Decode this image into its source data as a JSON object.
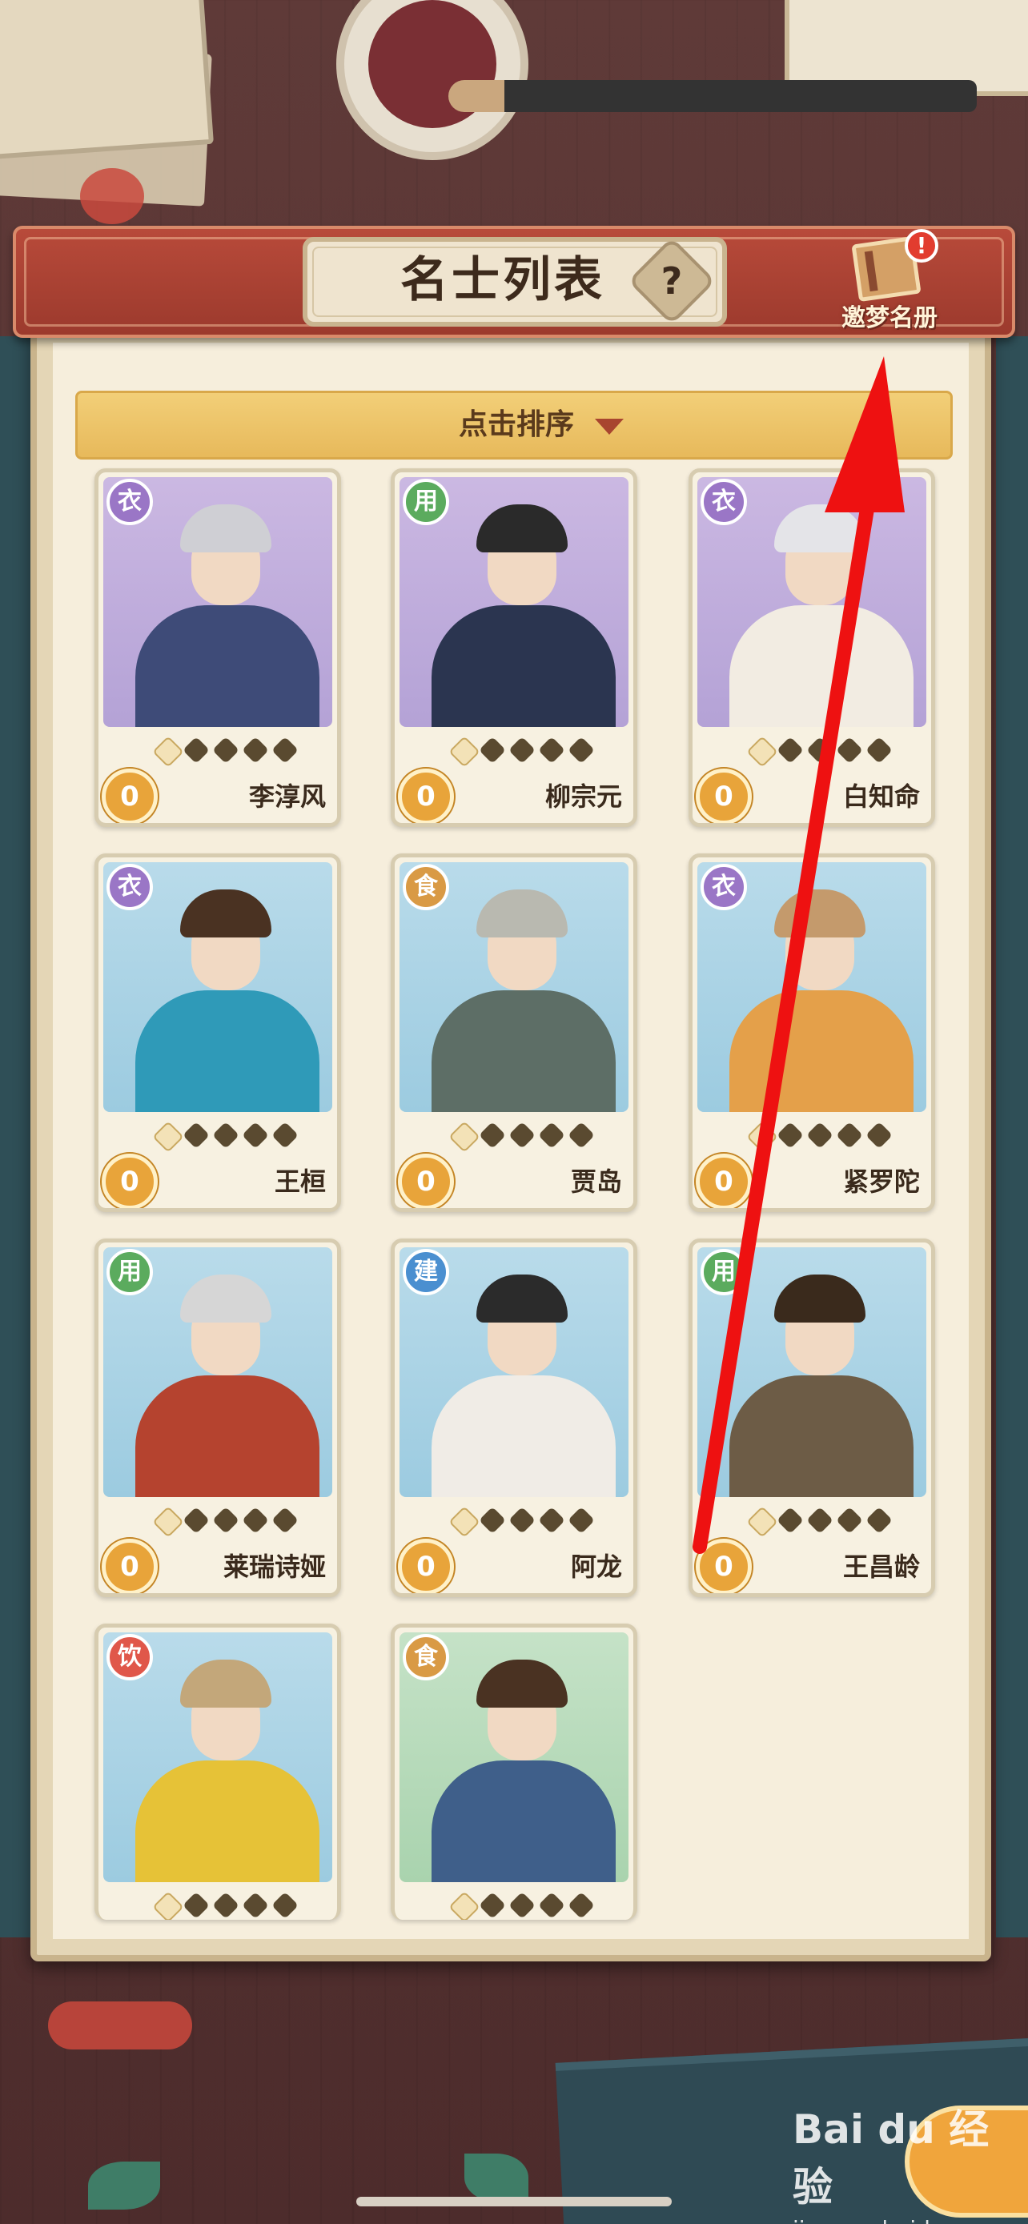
{
  "header": {
    "title": "名士列表",
    "help_glyph": "?",
    "roster_label": "邀梦名册",
    "roster_alert": "!"
  },
  "sort": {
    "label": "点击排序"
  },
  "cards": [
    {
      "name": "李淳风",
      "type": "衣",
      "type_color": "#9a76c6",
      "theme": "purple",
      "level": "0",
      "stars": 5
    },
    {
      "name": "柳宗元",
      "type": "用",
      "type_color": "#5bab5e",
      "theme": "purple",
      "level": "0",
      "stars": 5
    },
    {
      "name": "白知命",
      "type": "衣",
      "type_color": "#9a76c6",
      "theme": "purple",
      "level": "0",
      "stars": 5
    },
    {
      "name": "王桓",
      "type": "衣",
      "type_color": "#9a76c6",
      "theme": "blue",
      "level": "0",
      "stars": 5
    },
    {
      "name": "贾岛",
      "type": "食",
      "type_color": "#d99a45",
      "theme": "blue",
      "level": "0",
      "stars": 5
    },
    {
      "name": "紧罗陀",
      "type": "衣",
      "type_color": "#9a76c6",
      "theme": "blue",
      "level": "0",
      "stars": 5
    },
    {
      "name": "莱瑞诗娅",
      "type": "用",
      "type_color": "#5bab5e",
      "theme": "blue",
      "level": "0",
      "stars": 5
    },
    {
      "name": "阿龙",
      "type": "建",
      "type_color": "#4a8fd0",
      "theme": "blue",
      "level": "0",
      "stars": 5
    },
    {
      "name": "王昌龄",
      "type": "用",
      "type_color": "#5bab5e",
      "theme": "blue",
      "level": "0",
      "stars": 5
    },
    {
      "name": "",
      "type": "饮",
      "type_color": "#e0574a",
      "theme": "blue",
      "level": "",
      "stars": 5
    },
    {
      "name": "",
      "type": "食",
      "type_color": "#d99a45",
      "theme": "green",
      "level": "",
      "stars": 5
    }
  ],
  "watermark": {
    "logo": "Bai du 经验",
    "url": "jingyan.baidu.com"
  },
  "colors": {
    "annotation_arrow": "#ee1111",
    "header_red": "#a8402f",
    "sort_gold": "#ecc46a"
  }
}
